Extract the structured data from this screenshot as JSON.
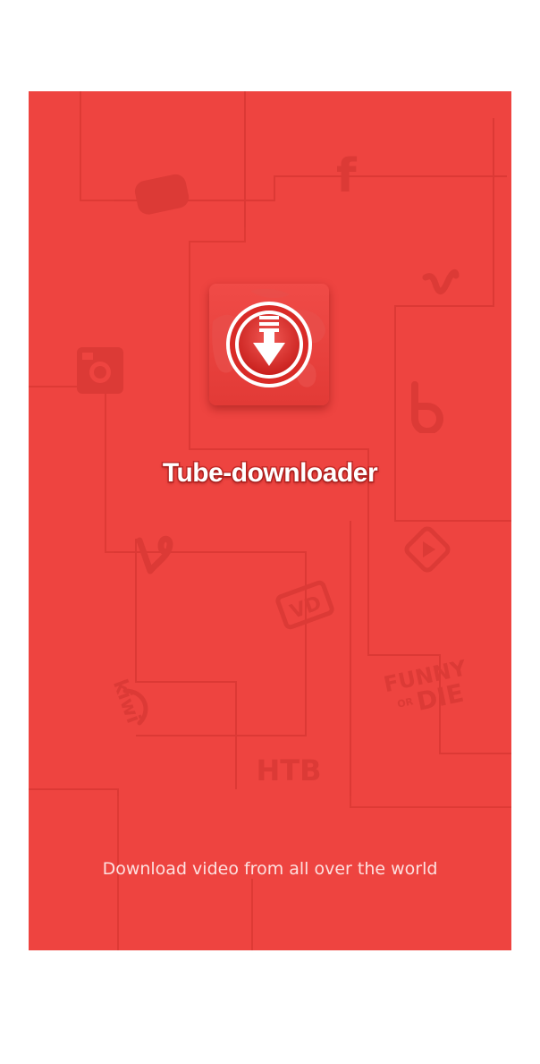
{
  "app": {
    "title": "Tube-downloader",
    "tagline": "Download video from all over the world"
  },
  "icons": {
    "app_logo": "download-arrow-globe-icon",
    "background": [
      "youtube-icon",
      "facebook-icon",
      "vimeo-icon",
      "instagram-icon",
      "vk-icon",
      "vine-icon",
      "play-icon",
      "video-icon",
      "kiwi-icon",
      "funny-or-die-icon",
      "ntv-icon"
    ],
    "funny_or_die_text": [
      "FUNNY",
      "OR",
      "DIE"
    ],
    "ntv_text": "HTB",
    "kiwi_text": "kiwi",
    "video_text": "VD"
  },
  "colors": {
    "background": "#ee4440",
    "title_stroke": "#c62b28",
    "tagline": "#fde0df"
  }
}
